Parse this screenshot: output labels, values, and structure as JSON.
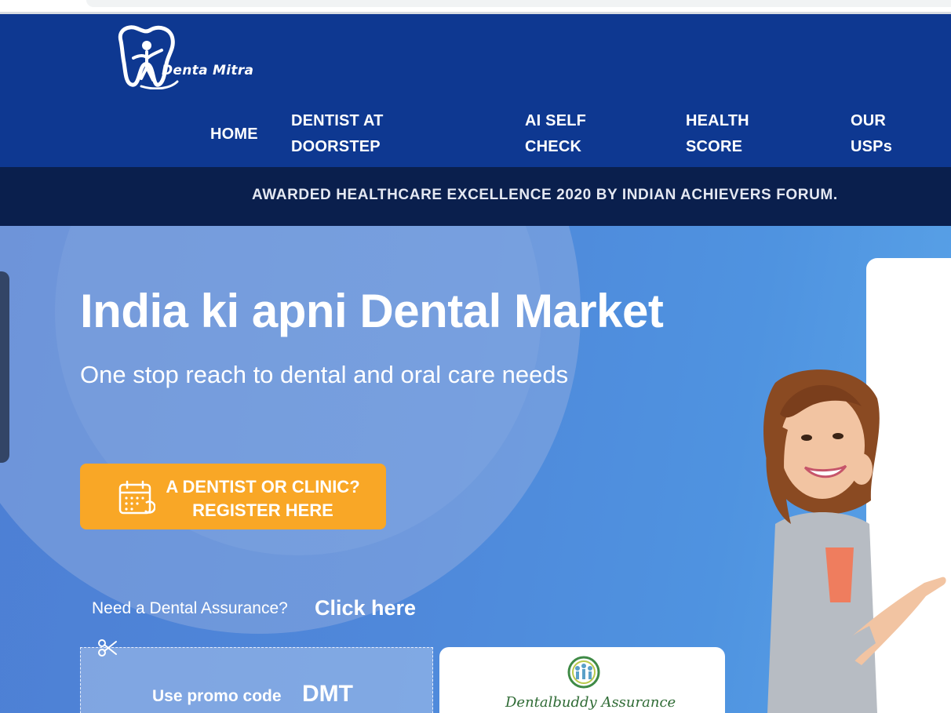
{
  "brand": {
    "name": "Denta Mitra"
  },
  "nav": {
    "items": [
      {
        "label_line1": "HOME",
        "label_line2": ""
      },
      {
        "label_line1": "DENTIST AT",
        "label_line2": "DOORSTEP"
      },
      {
        "label_line1": "AI SELF",
        "label_line2": "CHECK"
      },
      {
        "label_line1": "HEALTH",
        "label_line2": "SCORE"
      },
      {
        "label_line1": "OUR",
        "label_line2": "USPs"
      }
    ]
  },
  "award_banner": {
    "text": "AWARDED HEALTHCARE EXCELLENCE 2020 BY INDIAN ACHIEVERS FORUM."
  },
  "hero": {
    "title": "India ki apni Dental Market",
    "subtitle": "One stop reach to dental and oral care needs",
    "register_button": {
      "line1": "A DENTIST OR CLINIC?",
      "line2": "REGISTER HERE",
      "icon": "calendar-icon"
    },
    "assurance": {
      "question": "Need a Dental Assurance?",
      "link": "Click here"
    },
    "promo": {
      "label": "Use promo code",
      "code": "DMT",
      "icon": "scissors-icon"
    },
    "partner": {
      "name": "Dentalbuddy Assurance"
    }
  },
  "colors": {
    "header_bg": "#0e3891",
    "banner_bg": "#0a1f4d",
    "hero_bg": "#4f88da",
    "cta_orange": "#f9a726"
  }
}
